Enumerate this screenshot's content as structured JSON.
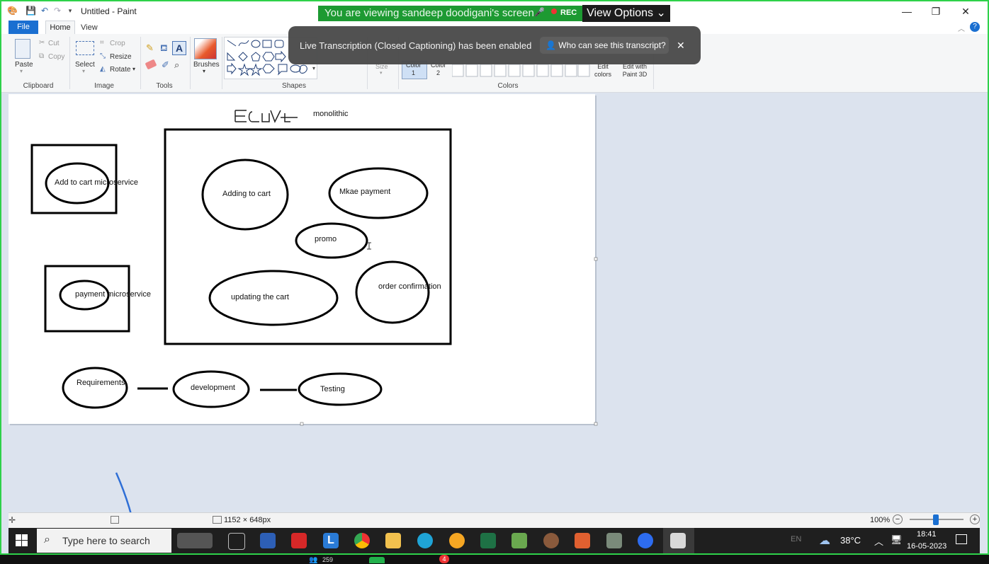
{
  "window": {
    "title": "Untitled - Paint",
    "minimize": "—",
    "maximize": "❐",
    "close": "✕",
    "help": "?"
  },
  "tabs": {
    "file": "File",
    "home": "Home",
    "view": "View"
  },
  "ribbon": {
    "clipboard": {
      "paste": "Paste",
      "cut": "Cut",
      "copy": "Copy",
      "label": "Clipboard"
    },
    "image": {
      "select": "Select",
      "crop": "Crop",
      "resize": "Resize",
      "rotate": "Rotate",
      "label": "Image"
    },
    "tools": {
      "label": "Tools"
    },
    "brushes": {
      "label": "Brushes"
    },
    "shapes": {
      "label": "Shapes"
    },
    "size": {
      "label": "Size"
    },
    "colors": {
      "color1": "Color",
      "color1_num": "1",
      "color2": "Color",
      "color2_num": "2",
      "edit_colors": "Edit colors",
      "edit_paint3d": "Edit with Paint 3D",
      "label": "Colors"
    }
  },
  "zoom": {
    "viewing": "You are viewing sandeep doodigani's screen",
    "rec": "REC",
    "view_options": "View Options",
    "toast_message": "Live Transcription (Closed Captioning) has been enabled",
    "toast_button": "Who can see this transcript?",
    "toast_close": "✕"
  },
  "canvas": {
    "monolithic": "monolithic",
    "add_to_cart": "Add to cart microservice",
    "payment_ms": "payment microservice",
    "adding_to_cart": "Adding to cart",
    "make_payment": "Mkae payment",
    "promo": "promo",
    "updating_cart": "updating the cart",
    "order_confirmation": "order confirmation",
    "requirements": "Requirements",
    "development": "development",
    "testing": "Testing"
  },
  "status": {
    "dimensions": "1152 × 648px",
    "zoom": "100%"
  },
  "taskbar": {
    "search": "Type here to search",
    "temp": "38°C",
    "lang": "EN",
    "time": "18:41",
    "date": "16-05-2023"
  },
  "bottom": {
    "participants": "259",
    "chat_badge": "4"
  }
}
